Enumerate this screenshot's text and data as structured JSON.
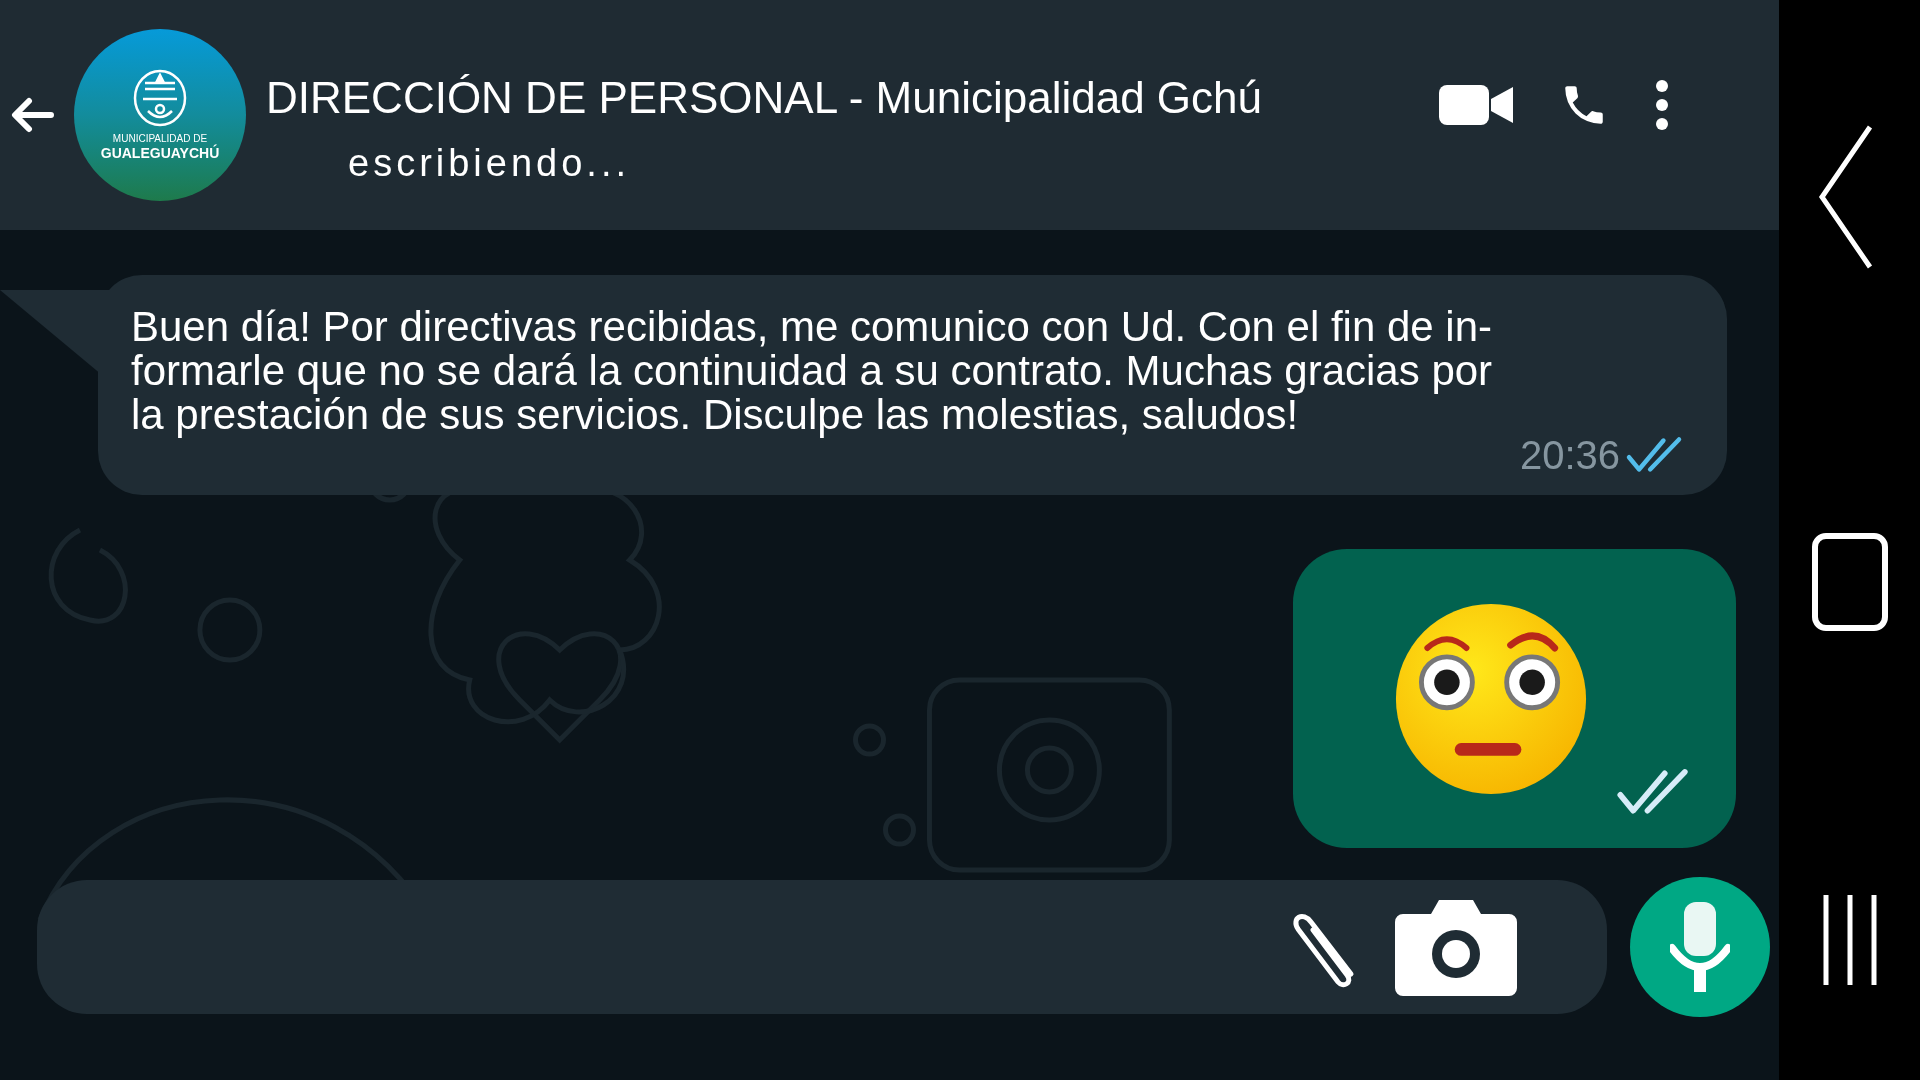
{
  "header": {
    "avatar": {
      "line_1": "MUNICIPALIDAD DE",
      "line_2": "GUALEGUAYCHÚ"
    },
    "title": "DIRECCIÓN DE PERSONAL - Municipalidad Gchú",
    "status": "escribiendo..."
  },
  "messages": [
    {
      "kind": "text",
      "outgoing": false,
      "lines": [
        "Buen día! Por directivas recibidas, me comunico con Ud. Con el fin de in-",
        "formarle que no se dará la continuidad a su contrato. Muchas gracias por",
        "la prestación de sus servicios. Disculpe las molestias, saludos!"
      ],
      "time": "20:36",
      "read": true
    },
    {
      "kind": "sticker",
      "outgoing": true,
      "read": false
    }
  ]
}
